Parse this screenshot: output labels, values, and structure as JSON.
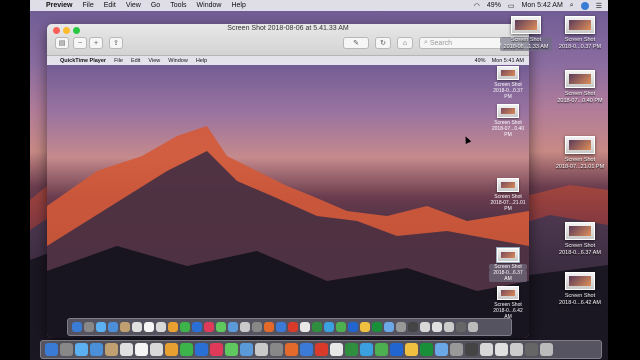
{
  "menubar": {
    "apple": "",
    "app": "Preview",
    "items": [
      "File",
      "Edit",
      "View",
      "Go",
      "Tools",
      "Window",
      "Help"
    ],
    "battery": "49%",
    "clock": "Mon 5:42 AM"
  },
  "window": {
    "title": "Screen Shot 2018-08-06 at 5.41.33 AM",
    "search_placeholder": "Search"
  },
  "inner_menubar": {
    "apple": "",
    "app": "QuickTime Player",
    "items": [
      "File",
      "Edit",
      "View",
      "Window",
      "Help"
    ],
    "battery": "49%",
    "clock": "Mon 5:41 AM"
  },
  "inner_icons": [
    {
      "line1": "Screen Shot",
      "line2": "2018-0...0.37 PM"
    },
    {
      "line1": "Screen Shot",
      "line2": "2018-07...0.40 PM"
    },
    {
      "line1": "Screen Shot",
      "line2": "2018-07...21.01 PM"
    },
    {
      "line1": "Screen Shot",
      "line2": "2018-0...6.37 AM"
    },
    {
      "line1": "Screen Shot",
      "line2": "2018-0...6.42 AM"
    }
  ],
  "desktop_icons": [
    {
      "line1": "Screen Shot",
      "line2": "2018-08...1.33 AM"
    },
    {
      "line1": "Screen Shot",
      "line2": "2018-0...0.37 PM"
    },
    {
      "line1": "Screen Shot",
      "line2": "2018-07...0.40 PM"
    },
    {
      "line1": "Screen Shot",
      "line2": "2018-07...21.01 PM"
    },
    {
      "line1": "Screen Shot",
      "line2": "2018-0...6.37 AM"
    },
    {
      "line1": "Screen Shot",
      "line2": "2018-0...6.42 AM"
    }
  ],
  "dock_colors": [
    "#3a7bd5",
    "#888",
    "#5ab0f0",
    "#4a8fd8",
    "#c0a070",
    "#e0e0e0",
    "#f5f5f5",
    "#d9d9d9",
    "#e8a030",
    "#3cb44a",
    "#2a6fd6",
    "#e03a5a",
    "#5ec75e",
    "#5a9ad8",
    "#c9c9c9",
    "#888",
    "#e36a2a",
    "#3c7ad8",
    "#d93a2a",
    "#e8e8e8",
    "#2f8f3f",
    "#3aa0e0",
    "#4caf50",
    "#2166d0",
    "#f0c040",
    "#1a8f3a",
    "#6aa8e8",
    "#999",
    "#444",
    "#d8d8d8",
    "#e0e0e0",
    "#ccc",
    "#666",
    "#bbb"
  ],
  "colors": {
    "accent": "#3a7bd5"
  }
}
